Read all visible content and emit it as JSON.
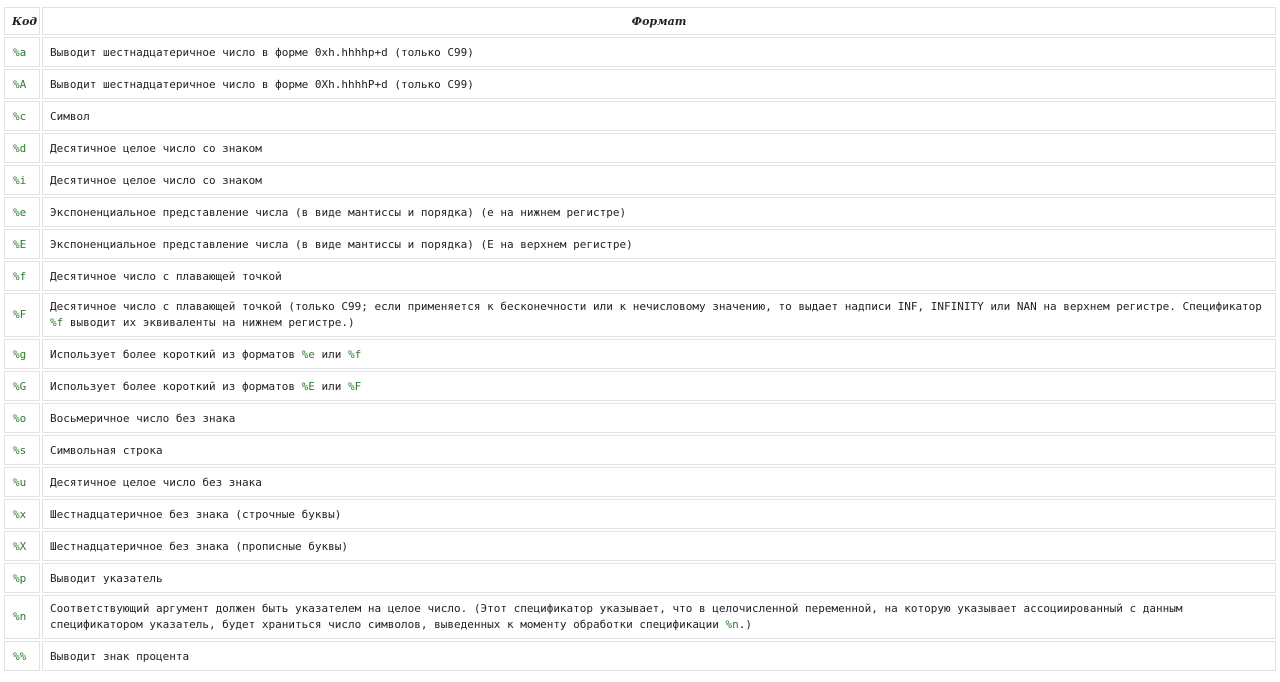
{
  "table": {
    "headers": {
      "code": "Код",
      "format": "Формат"
    },
    "rows": [
      {
        "code": "%a",
        "desc": [
          "Выводит шестнадцатеричное число в форме 0xh.hhhhp+d (только C99)"
        ]
      },
      {
        "code": "%A",
        "desc": [
          "Выводит шестнадцатеричное число в форме 0Xh.hhhhP+d (только C99)"
        ]
      },
      {
        "code": "%c",
        "desc": [
          "Символ"
        ]
      },
      {
        "code": "%d",
        "desc": [
          "Десятичное целое число со знаком"
        ]
      },
      {
        "code": "%i",
        "desc": [
          "Десятичное целое число со знаком"
        ]
      },
      {
        "code": "%e",
        "desc": [
          "Экспоненциальное представление числа (в виде мантиссы и порядка) (е на нижнем регистре)"
        ]
      },
      {
        "code": "%E",
        "desc": [
          "Экспоненциальное представление числа (в виде мантиссы и порядка) (Е на верхнем регистре)"
        ]
      },
      {
        "code": "%f",
        "desc": [
          "Десятичное число с плавающей точкой"
        ]
      },
      {
        "code": "%F",
        "desc": [
          "Десятичное число с плавающей точкой (только C99; если применяется к бесконечности или к нечисловому значению, то выдает надписи INF, INFINITY или NAN на верхнем регистре. Спецификатор ",
          {
            "hl": "%f"
          },
          " выводит их эквиваленты на нижнем регистре.)"
        ]
      },
      {
        "code": "%g",
        "desc": [
          "Использует более короткий из форматов ",
          {
            "hl": "%e"
          },
          " или ",
          {
            "hl": "%f"
          }
        ]
      },
      {
        "code": "%G",
        "desc": [
          "Использует более короткий из форматов ",
          {
            "hl": "%E"
          },
          " или ",
          {
            "hl": "%F"
          }
        ]
      },
      {
        "code": "%o",
        "desc": [
          "Восьмеричное число без знака"
        ]
      },
      {
        "code": "%s",
        "desc": [
          "Символьная строка"
        ]
      },
      {
        "code": "%u",
        "desc": [
          "Десятичное целое число без знака"
        ]
      },
      {
        "code": "%x",
        "desc": [
          "Шестнадцатеричное без знака (строчные буквы)"
        ]
      },
      {
        "code": "%X",
        "desc": [
          "Шестнадцатеричное без знака (прописные буквы)"
        ]
      },
      {
        "code": "%p",
        "desc": [
          "Выводит указатель"
        ]
      },
      {
        "code": "%n",
        "desc": [
          "Соответствующий аргумент должен быть указателем на целое число. (Этот спецификатор указывает, что в целочисленной переменной, на которую указывает ассоциированный с данным спецификатором указатель, будет храниться число символов, выведенных к моменту обработки спецификации ",
          {
            "hl": "%n"
          },
          ".)"
        ]
      },
      {
        "code": "%%",
        "desc": [
          "Выводит знак процента"
        ]
      }
    ]
  },
  "colors": {
    "code_text": "#2e7d2e",
    "border": "#e2e2e2",
    "text": "#222222"
  }
}
